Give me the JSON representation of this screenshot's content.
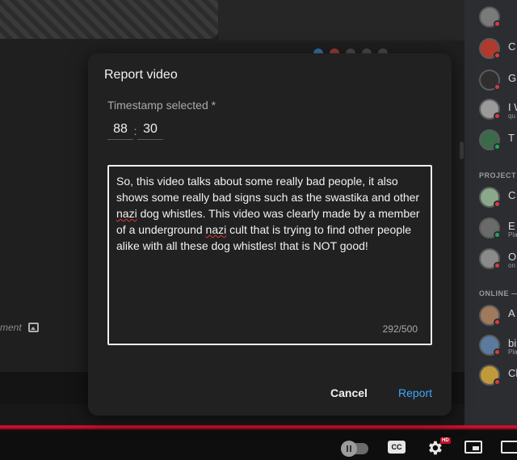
{
  "modal": {
    "title": "Report video",
    "timestamp_label": "Timestamp selected *",
    "timestamp_minutes": "88",
    "timestamp_separator": ":",
    "timestamp_seconds": "30",
    "description_parts": [
      "So, this video talks about some really bad people, it also shows some really bad signs such as the swastika and other ",
      "nazi",
      " dog whistles. This video was clearly made by a member of a underground ",
      "nazi",
      " cult that is trying to find other people alike with all these dog whistles! that is NOT good!"
    ],
    "char_count": "292/500",
    "cancel_label": "Cancel",
    "report_label": "Report"
  },
  "background": {
    "comment_hint": "ment"
  },
  "player": {
    "cc_label": "CC",
    "hd_badge": "HD"
  },
  "sidebar": {
    "section_project": "PROJECT",
    "section_online": "ONLINE —",
    "members": [
      {
        "name": "",
        "sub": "",
        "status": "red",
        "color": "#7a7a7a"
      },
      {
        "name": "C",
        "sub": "",
        "status": "red",
        "color": "#b03a2e"
      },
      {
        "name": "G",
        "sub": "",
        "status": "red",
        "color": "#2f2f2f"
      },
      {
        "name": "I W",
        "sub": "qu",
        "status": "red",
        "color": "#9a9a9a"
      },
      {
        "name": "T",
        "sub": "",
        "status": "green",
        "color": "#3a6a4a"
      },
      {
        "name": "C",
        "sub": "",
        "status": "red",
        "color": "#8aa88a"
      },
      {
        "name": "E",
        "sub": "Pla",
        "status": "green",
        "color": "#6a6a6a"
      },
      {
        "name": "O",
        "sub": "on",
        "status": "red",
        "color": "#8a8a8a"
      },
      {
        "name": "A",
        "sub": "",
        "status": "red",
        "color": "#a07a5a"
      },
      {
        "name": "bi",
        "sub": "Pla",
        "status": "red",
        "color": "#5a7aa0"
      },
      {
        "name": "Cl",
        "sub": "",
        "status": "red",
        "color": "#c09a3a"
      }
    ]
  },
  "colors": {
    "accent": "#3ea6ff",
    "progress": "#c4102a",
    "modal_bg": "#212121"
  }
}
